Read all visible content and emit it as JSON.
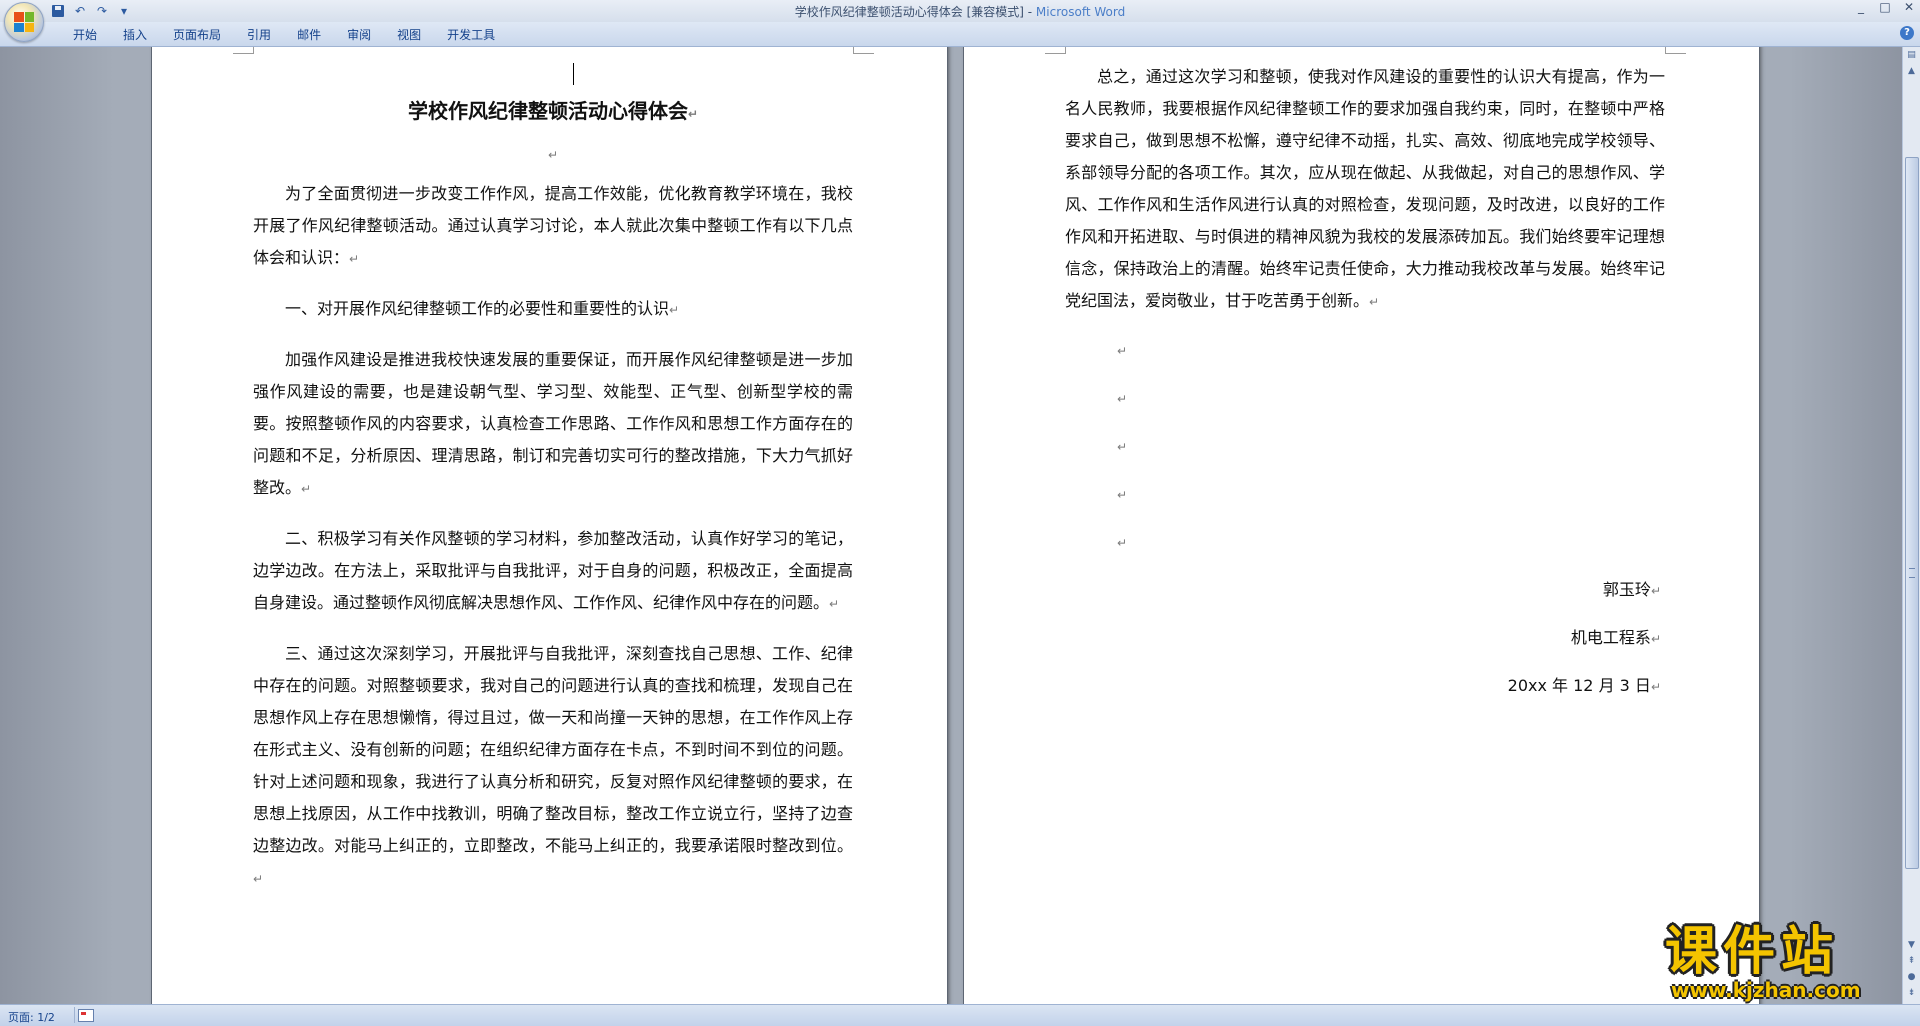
{
  "window": {
    "title_doc": "学校作风纪律整顿活动心得体会 [兼容模式] - ",
    "title_app": "Microsoft Word",
    "controls": [
      "_",
      "□",
      "✕"
    ]
  },
  "ribbon": {
    "tabs": [
      "开始",
      "插入",
      "页面布局",
      "引用",
      "邮件",
      "审阅",
      "视图",
      "开发工具"
    ]
  },
  "document": {
    "title": "学校作风纪律整顿活动心得体会",
    "paragraph_mark": "↵",
    "page1": [
      "为了全面贯彻进一步改变工作作风，提高工作效能，优化教育教学环境在，我校开展了作风纪律整顿活动。通过认真学习讨论，本人就此次集中整顿工作有以下几点体会和认识：",
      "一、对开展作风纪律整顿工作的必要性和重要性的认识",
      "加强作风建设是推进我校快速发展的重要保证，而开展作风纪律整顿是进一步加强作风建设的需要，也是建设朝气型、学习型、效能型、正气型、创新型学校的需要。按照整顿作风的内容要求，认真检查工作思路、工作作风和思想工作方面存在的问题和不足，分析原因、理清思路，制订和完善切实可行的整改措施，下大力气抓好整改。",
      "二、积极学习有关作风整顿的学习材料，参加整改活动，认真作好学习的笔记，边学边改。在方法上，采取批评与自我批评，对于自身的问题，积极改正，全面提高自身建设。通过整顿作风彻底解决思想作风、工作作风、纪律作风中存在的问题。",
      "三、通过这次深刻学习，开展批评与自我批评，深刻查找自己思想、工作、纪律中存在的问题。对照整顿要求，我对自己的问题进行认真的查找和梳理，发现自己在思想作风上存在思想懒惰，得过且过，做一天和尚撞一天钟的思想，在工作作风上存在形式主义、没有创新的问题；在组织纪律方面存在卡点，不到时间不到位的问题。针对上述问题和现象，我进行了认真分析和研究，反复对照作风纪律整顿的要求，在思想上找原因，从工作中找教训，明确了整改目标，整改工作立说立行，坚持了边查边整边改。对能马上纠正的，立即整改，不能马上纠正的，我要承诺限时整改到位。"
    ],
    "page2": [
      "总之，通过这次学习和整顿，使我对作风建设的重要性的认识大有提高，作为一名人民教师，我要根据作风纪律整顿工作的要求加强自我约束，同时，在整顿中严格要求自己，做到思想不松懈，遵守纪律不动摇，扎实、高效、彻底地完成学校领导、系部领导分配的各项工作。其次，应从现在做起、从我做起，对自己的思想作风、学风、工作作风和生活作风进行认真的对照检查，发现问题，及时改进，以良好的工作作风和开拓进取、与时俱进的精神风貌为我校的发展添砖加瓦。我们始终要牢记理想信念，保持政治上的清醒。始终牢记责任使命，大力推动我校改革与发展。始终牢记党纪国法，爱岗敬业，甘于吃苦勇于创新。"
    ],
    "signature": {
      "name": "郭玉玲",
      "department": "机电工程系",
      "date": "20xx 年 12 月 3 日"
    }
  },
  "statusbar": {
    "page": "页面: 1/2"
  },
  "watermark": {
    "big": "课件站",
    "small": "www.kjzhan.com"
  }
}
